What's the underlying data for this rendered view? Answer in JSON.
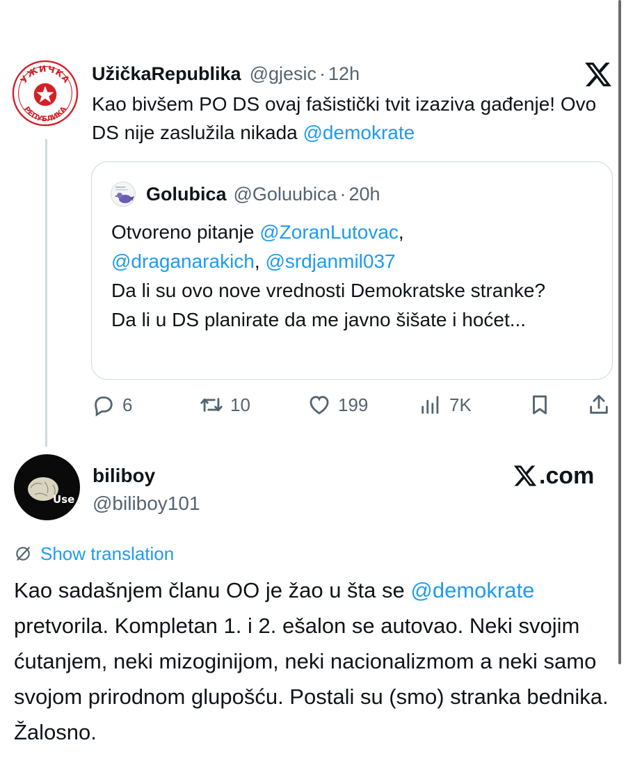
{
  "tweet": {
    "author_name": "UžičkaRepublika",
    "author_handle": "@gjesic",
    "separator": "·",
    "time": "12h",
    "avatar_text_top": "УЖИЧКА",
    "avatar_text_bottom": "РЕПУБЛИКА",
    "text_before": "Kao bivšem PO DS ovaj fašistički tvit izaziva gađenje! Ovo DS nije zaslužila nikada ",
    "text_mention": "@demokrate",
    "brand_icon": "x-logo-icon",
    "accent_color": "#1d9bf0"
  },
  "quoted": {
    "author_name": "Golubica",
    "author_handle": "@Goluubica",
    "separator": "·",
    "time": "20h",
    "line1_text": "Otvoreno pitanje ",
    "mention1": "@ZoranLutovac",
    "comma1": ",",
    "mention2": "@draganarakich",
    "comma2": ", ",
    "mention3": "@srdjanmil037",
    "line3": "Da li su ovo nove vrednosti Demokratske stranke?",
    "line4": "Da li u DS planirate da me javno šišate i hoćet..."
  },
  "actions": {
    "replies": "6",
    "reposts": "10",
    "likes": "199",
    "views": "7K"
  },
  "reply": {
    "author_name": "biliboy",
    "author_handle": "@biliboy101",
    "avatar_label": "Use",
    "brand_domain": ".com",
    "translation_label": "Show translation",
    "text_before": "Kao sadašnjem članu OO je žao u šta se ",
    "text_mention": "@demokrate",
    "text_after": " pretvorila. Kompletan 1. i 2. ešalon se autovao. Neki svojim ćutanjem, neki mizoginijom, neki nacionalizmom a neki samo svojom prirodnom glupošću. Postali su (smo) stranka bednika. Žalosno."
  }
}
